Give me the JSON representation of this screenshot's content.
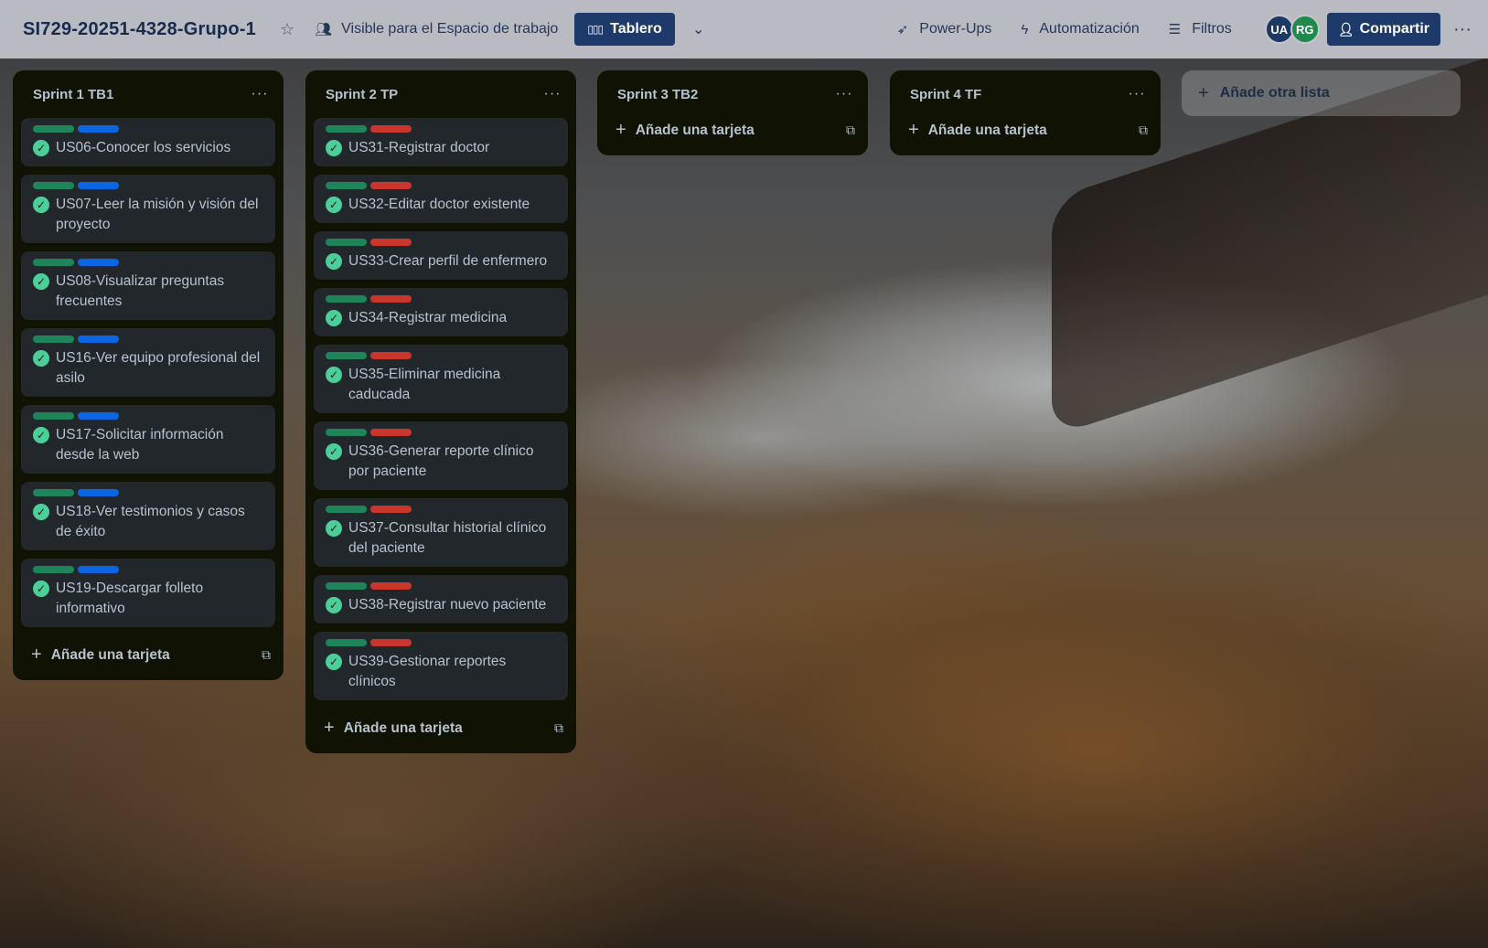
{
  "header": {
    "board_title": "SI729-20251-4328-Grupo-1",
    "visibility_label": "Visible para el Espacio de trabajo",
    "view_label": "Tablero",
    "powerups_label": "Power-Ups",
    "automation_label": "Automatización",
    "filters_label": "Filtros",
    "avatars": [
      "UA",
      "RG"
    ],
    "share_label": "Compartir"
  },
  "lists": [
    {
      "title": "Sprint 1 TB1",
      "add_card_label": "Añade una tarjeta",
      "cards": [
        {
          "title": "US06-Conocer los servicios",
          "labels": [
            "green",
            "blue"
          ]
        },
        {
          "title": "US07-Leer la misión y visión del proyecto",
          "labels": [
            "green",
            "blue"
          ]
        },
        {
          "title": "US08-Visualizar preguntas frecuentes",
          "labels": [
            "green",
            "blue"
          ]
        },
        {
          "title": "US16-Ver equipo profesional del asilo",
          "labels": [
            "green",
            "blue"
          ]
        },
        {
          "title": "US17-Solicitar información desde la web",
          "labels": [
            "green",
            "blue"
          ]
        },
        {
          "title": "US18-Ver testimonios y casos de éxito",
          "labels": [
            "green",
            "blue"
          ]
        },
        {
          "title": "US19-Descargar folleto informativo",
          "labels": [
            "green",
            "blue"
          ]
        }
      ]
    },
    {
      "title": "Sprint 2 TP",
      "add_card_label": "Añade una tarjeta",
      "cards": [
        {
          "title": "US31-Registrar doctor",
          "labels": [
            "green",
            "red"
          ]
        },
        {
          "title": "US32-Editar doctor existente",
          "labels": [
            "green",
            "red"
          ]
        },
        {
          "title": "US33-Crear perfil de enfermero",
          "labels": [
            "green",
            "red"
          ]
        },
        {
          "title": "US34-Registrar medicina",
          "labels": [
            "green",
            "red"
          ]
        },
        {
          "title": "US35-Eliminar medicina caducada",
          "labels": [
            "green",
            "red"
          ]
        },
        {
          "title": "US36-Generar reporte clínico por paciente",
          "labels": [
            "green",
            "red"
          ]
        },
        {
          "title": "US37-Consultar historial clínico del paciente",
          "labels": [
            "green",
            "red"
          ]
        },
        {
          "title": "US38-Registrar nuevo paciente",
          "labels": [
            "green",
            "red"
          ]
        },
        {
          "title": "US39-Gestionar reportes clínicos",
          "labels": [
            "green",
            "red"
          ]
        }
      ]
    },
    {
      "title": "Sprint 3 TB2",
      "add_card_label": "Añade una tarjeta",
      "cards": []
    },
    {
      "title": "Sprint 4 TF",
      "add_card_label": "Añade una tarjeta",
      "cards": []
    }
  ],
  "add_list_label": "Añade otra lista",
  "colors": {
    "label_green": "#1f845a",
    "label_blue": "#0c66e4",
    "label_red": "#c9372c",
    "complete_check": "#4bce97",
    "header_button": "#1e3a6b"
  },
  "icons": {
    "star": "star-icon",
    "visibility": "people-icon",
    "view": "board-icon",
    "dropdown": "chevron-down-icon",
    "powerups": "rocket-icon",
    "automation": "lightning-icon",
    "filters": "filter-icon",
    "share": "add-person-icon",
    "more": "more-icon",
    "plus": "plus-icon",
    "template": "template-icon",
    "complete": "check-circle-icon"
  }
}
